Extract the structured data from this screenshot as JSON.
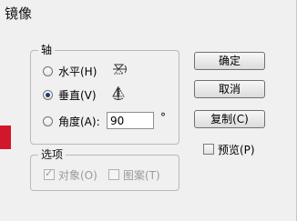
{
  "window": {
    "title": "镜像"
  },
  "axis": {
    "caption": "轴",
    "horizontal_label": "水平(H)",
    "vertical_label": "垂直(V)",
    "angle_label": "角度(A):",
    "angle_value": "90",
    "degree_symbol": "°",
    "selected": "vertical",
    "icons": {
      "horizontal": "horizontal-axis-icon",
      "vertical": "vertical-axis-icon"
    }
  },
  "options": {
    "caption": "选项",
    "objects_label": "对象(O)",
    "objects_checked": true,
    "pattern_label": "图案(T)",
    "pattern_checked": false
  },
  "buttons": {
    "ok": "确定",
    "cancel": "取消",
    "copy": "复制(C)"
  },
  "preview": {
    "label": "预览(P)",
    "checked": false
  },
  "colors": {
    "accent_marker": "#d3172a",
    "dialog_bg": "#f0f0f0"
  }
}
